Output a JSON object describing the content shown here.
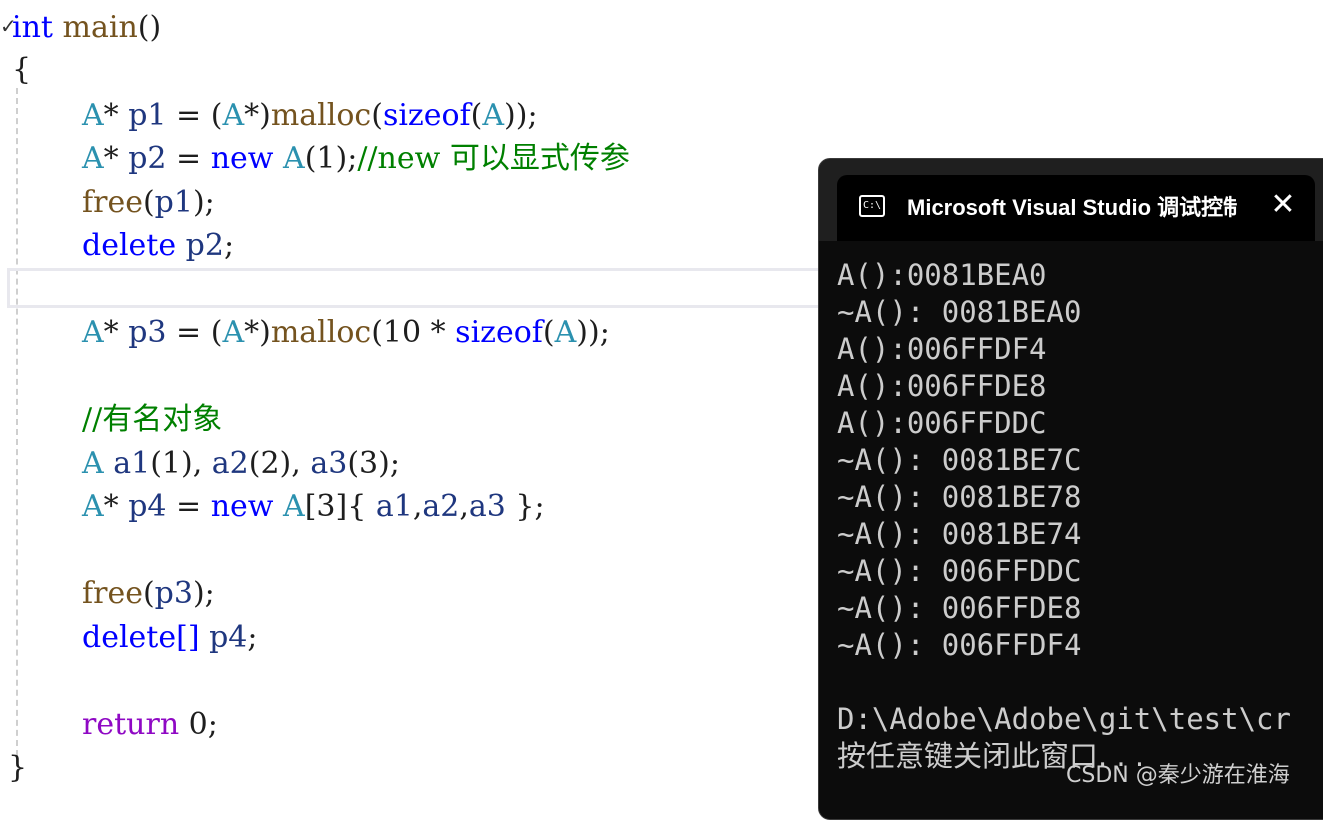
{
  "editor": {
    "signature": {
      "type": "int",
      "name": "main",
      "parens": "()"
    },
    "open_brace": "{",
    "close_brace": "}",
    "lines": {
      "l1": {
        "t1": "A",
        "op1": "*",
        "v1": "p1",
        "eq": " = (",
        "t2": "A",
        "op2": "*)",
        "fn": "malloc",
        "p1": "(",
        "kw": "sizeof",
        "p2": "(",
        "t3": "A",
        "end": "));"
      },
      "l2": {
        "t1": "A",
        "op1": "*",
        "v1": "p2",
        "eq": " = ",
        "kw": "new",
        "t2": "A",
        "args": "(1);",
        "cm": "//new 可以显式传参"
      },
      "l3": {
        "fn": "free",
        "p": "(",
        "v": "p1",
        "end": ");"
      },
      "l4": {
        "kw": "delete",
        "v": "p2",
        "end": ";"
      },
      "l5": {
        "t1": "A",
        "op1": "*",
        "v1": "p3",
        "eq": " = (",
        "t2": "A",
        "op2": "*)",
        "fn": "malloc",
        "mid": "(10 * ",
        "kw": "sizeof",
        "p2": "(",
        "t3": "A",
        "end": "));"
      },
      "l6": {
        "cm": "//有名对象"
      },
      "l7": {
        "t": "A",
        "v1": "a1",
        "a1": "(1), ",
        "v2": "a2",
        "a2": "(2), ",
        "v3": "a3",
        "a3": "(3);"
      },
      "l8": {
        "t1": "A",
        "op1": "*",
        "v1": "p4",
        "eq": " = ",
        "kw": "new",
        "t2": "A",
        "br": "[3]{ ",
        "v2": "a1",
        ",1": ",",
        "v3": "a2",
        ",2": ",",
        "v4": "a3",
        "end": " };"
      },
      "l9": {
        "fn": "free",
        "p": "(",
        "v": "p3",
        "end": ");"
      },
      "l10": {
        "kw": "delete[]",
        "v": "p4",
        "end": ";"
      },
      "l11": {
        "kw": "return",
        "val": " 0;"
      }
    }
  },
  "console": {
    "icon": "C:\\",
    "title": "Microsoft Visual Studio 调试控制台",
    "close_icon": "✕",
    "output": [
      "A():0081BEA0",
      "~A(): 0081BEA0",
      "A():006FFDF4",
      "A():006FFDE8",
      "A():006FFDDC",
      "~A(): 0081BE7C",
      "~A(): 0081BE78",
      "~A(): 0081BE74",
      "~A(): 006FFDDC",
      "~A(): 006FFDE8",
      "~A(): 006FFDF4",
      "",
      "D:\\Adobe\\Adobe\\git\\test\\cr",
      "按任意键关闭此窗口. . ."
    ]
  },
  "watermark": "CSDN @秦少游在淮海"
}
